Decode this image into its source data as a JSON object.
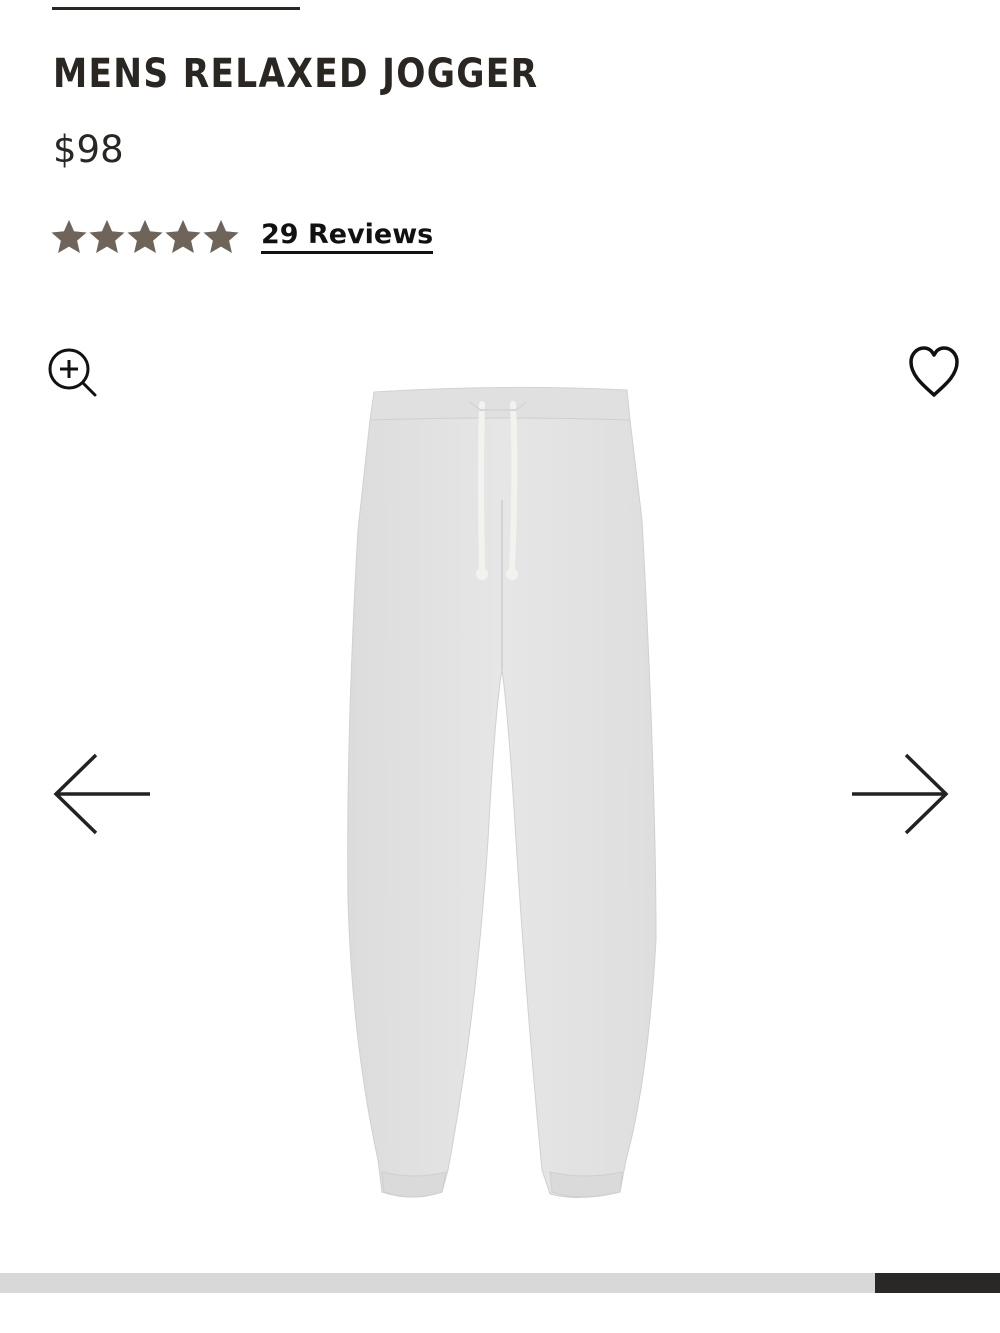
{
  "product": {
    "title": "MENS RELAXED JOGGER",
    "price": "$98",
    "rating": 5,
    "rating_max": 5,
    "reviews_label": "29 Reviews"
  },
  "icons": {
    "zoom": "zoom-in-icon",
    "favorite": "heart-icon",
    "previous": "arrow-left-icon",
    "next": "arrow-right-icon",
    "star": "star-icon"
  },
  "colors": {
    "text": "#2a2622",
    "star": "#6e645a",
    "progress_track": "#d8d8d8",
    "progress_fill": "#2a2826",
    "product_fabric": "#e3e3e3"
  },
  "gallery": {
    "slide_progress_start": 0.875,
    "slide_progress_end": 1.0
  }
}
